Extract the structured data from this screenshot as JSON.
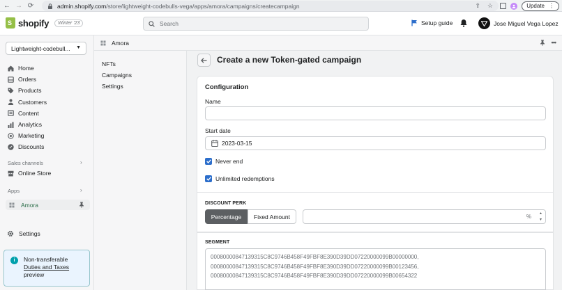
{
  "browser": {
    "url_host": "admin.shopify.com",
    "url_path": "/store/lightweight-codebulls-vega/apps/amora/campaigns/createcampaign",
    "update_label": "Update"
  },
  "topbar": {
    "brand": "shopify",
    "version_badge": "Winter '23",
    "search_placeholder": "Search",
    "setup_guide": "Setup guide",
    "user_name": "Jose Miguel Vega Lopez"
  },
  "sidebar": {
    "store_name": "Lightweight-codebull...",
    "items": [
      {
        "label": "Home",
        "icon": "home-icon"
      },
      {
        "label": "Orders",
        "icon": "orders-icon"
      },
      {
        "label": "Products",
        "icon": "tag-icon"
      },
      {
        "label": "Customers",
        "icon": "person-icon"
      },
      {
        "label": "Content",
        "icon": "content-icon"
      },
      {
        "label": "Analytics",
        "icon": "bar-chart-icon"
      },
      {
        "label": "Marketing",
        "icon": "target-icon"
      },
      {
        "label": "Discounts",
        "icon": "discount-icon"
      }
    ],
    "sales_channels_label": "Sales channels",
    "online_store": "Online Store",
    "apps_label": "Apps",
    "active_app": "Amora",
    "settings": "Settings",
    "notice": {
      "line1": "Non-transferable",
      "link": "Duties and Taxes",
      "line3": "preview"
    }
  },
  "app_header": {
    "title": "Amora"
  },
  "app_nav": {
    "items": [
      "NFTs",
      "Campaigns",
      "Settings"
    ]
  },
  "page": {
    "title": "Create a new Token-gated campaign"
  },
  "configuration": {
    "title": "Configuration",
    "name_label": "Name",
    "name_value": "",
    "start_date_label": "Start date",
    "start_date_value": "2023-03-15",
    "never_end_label": "Never end",
    "never_end_checked": true,
    "unlimited_label": "Unlimited redemptions",
    "unlimited_checked": true
  },
  "discount_perk": {
    "heading": "DISCOUNT PERK",
    "options": [
      "Percentage",
      "Fixed Amount"
    ],
    "selected": "Percentage",
    "value": "",
    "suffix": "%"
  },
  "segment": {
    "heading": "SEGMENT",
    "lines": [
      "00080000847139315C8C9746B458F49FBF8E390D39DD07220000099B00000000,",
      "00080000847139315C8C9746B458F49FBF8E390D39DD07220000099B00123456,",
      "00080000847139315C8C9746B458F49FBF8E390D39DD07220000099B00654322"
    ]
  }
}
